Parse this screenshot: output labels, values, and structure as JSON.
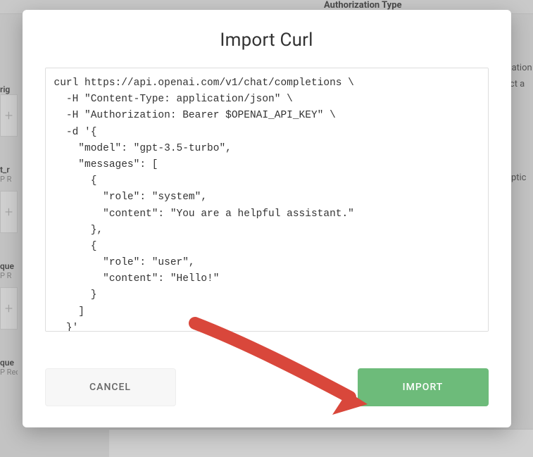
{
  "background": {
    "header_label": "Authorization Type",
    "right_label_1": "ization",
    "right_label_2": "ect a",
    "right_label_3": "Optic",
    "left_frag_1": "rig",
    "node_label_trunc_1": "t_r",
    "node_sub_1": "P R",
    "node_label_trunc_2": "que",
    "node_sub_2": "P R",
    "node_label_trunc_3": "que",
    "node_sub_3": "P Request"
  },
  "modal": {
    "title": "Import Curl",
    "curl_text": "curl https://api.openai.com/v1/chat/completions \\\n  -H \"Content-Type: application/json\" \\\n  -H \"Authorization: Bearer $OPENAI_API_KEY\" \\\n  -d '{\n    \"model\": \"gpt-3.5-turbo\",\n    \"messages\": [\n      {\n        \"role\": \"system\",\n        \"content\": \"You are a helpful assistant.\"\n      },\n      {\n        \"role\": \"user\",\n        \"content\": \"Hello!\"\n      }\n    ]\n  }'",
    "cancel_label": "CANCEL",
    "import_label": "IMPORT"
  }
}
